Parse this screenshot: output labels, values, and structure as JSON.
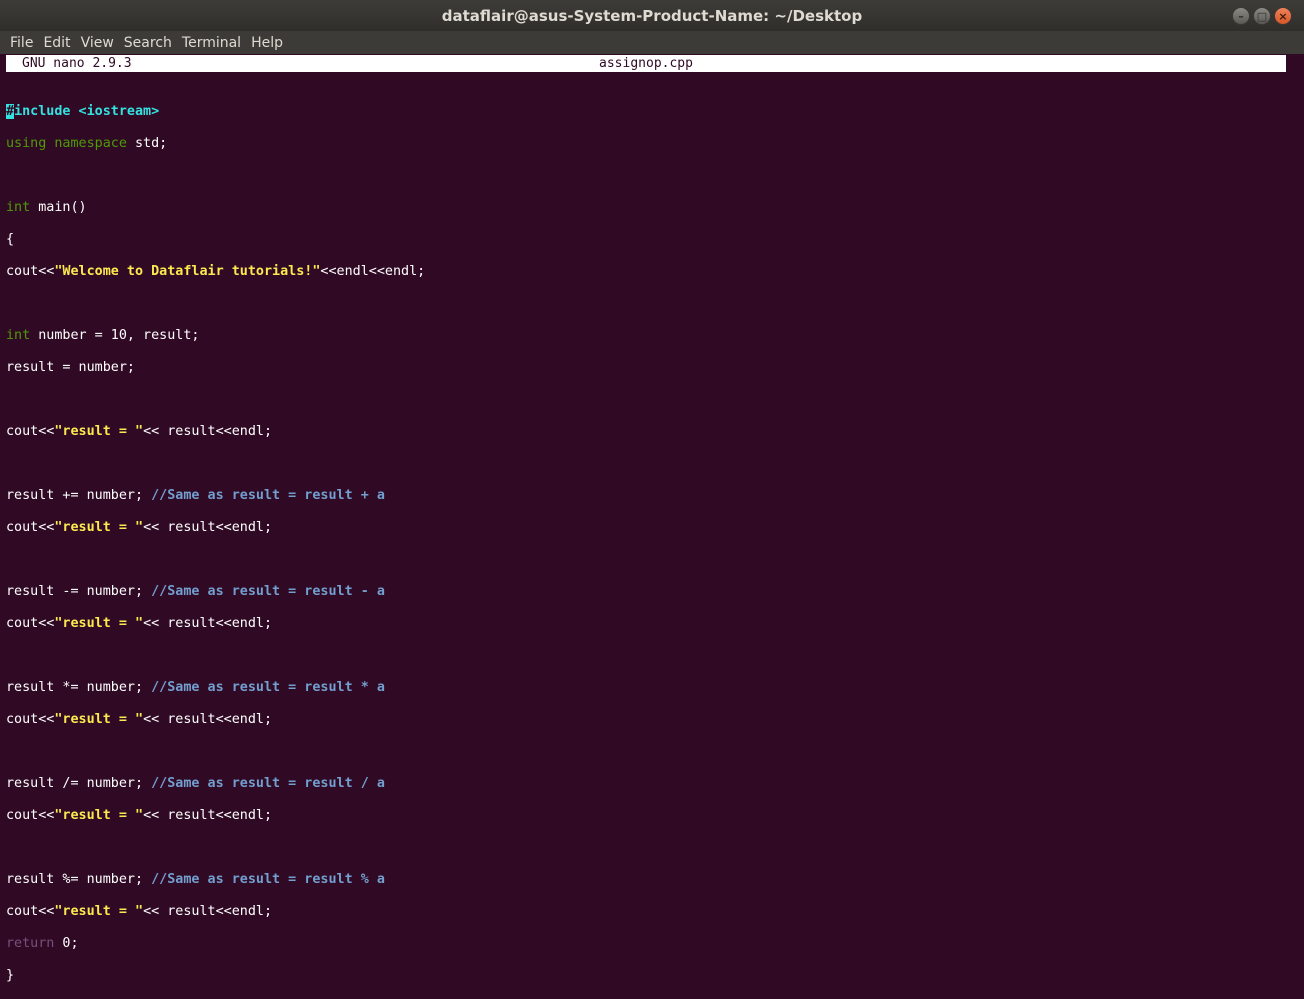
{
  "window": {
    "title": "dataflair@asus-System-Product-Name: ~/Desktop",
    "buttons": {
      "minimize": "–",
      "maximize": "□",
      "close": "×"
    }
  },
  "menu": [
    "File",
    "Edit",
    "View",
    "Search",
    "Terminal",
    "Help"
  ],
  "nano": {
    "version": "GNU nano 2.9.3",
    "filename": "assignop.cpp"
  },
  "code": {
    "l01a": "#",
    "l01b": "include <iostream>",
    "l02a": "using namespace",
    "l02b": " std;",
    "l04a": "int",
    "l04b": " main()",
    "l05": "{",
    "l06a": "cout<<",
    "l06b": "\"Welcome to Dataflair tutorials!\"",
    "l06c": "<<endl<<endl;",
    "l08a": "int",
    "l08b": " number = 10, result;",
    "l09": "result = number;",
    "l11a": "cout<<",
    "l11b": "\"result = \"",
    "l11c": "<< result<<endl;",
    "l13a": "result += number; ",
    "l13b": "//Same as result = result + a",
    "l14a": "cout<<",
    "l14b": "\"result = \"",
    "l14c": "<< result<<endl;",
    "l16a": "result -= number; ",
    "l16b": "//Same as result = result - a",
    "l17a": "cout<<",
    "l17b": "\"result = \"",
    "l17c": "<< result<<endl;",
    "l19a": "result *= number; ",
    "l19b": "//Same as result = result * a",
    "l20a": "cout<<",
    "l20b": "\"result = \"",
    "l20c": "<< result<<endl;",
    "l22a": "result /= number; ",
    "l22b": "//Same as result = result / a",
    "l23a": "cout<<",
    "l23b": "\"result = \"",
    "l23c": "<< result<<endl;",
    "l25a": "result %= number; ",
    "l25b": "//Same as result = result % a",
    "l26a": "cout<<",
    "l26b": "\"result = \"",
    "l26c": "<< result<<endl;",
    "l27a": "return",
    "l27b": " 0;",
    "l28": "}"
  },
  "colors": {
    "background": "#300a24",
    "string": "#fce94f",
    "comment": "#729fcf",
    "type": "#4e9a06",
    "preprocessor": "#34e2e2"
  }
}
